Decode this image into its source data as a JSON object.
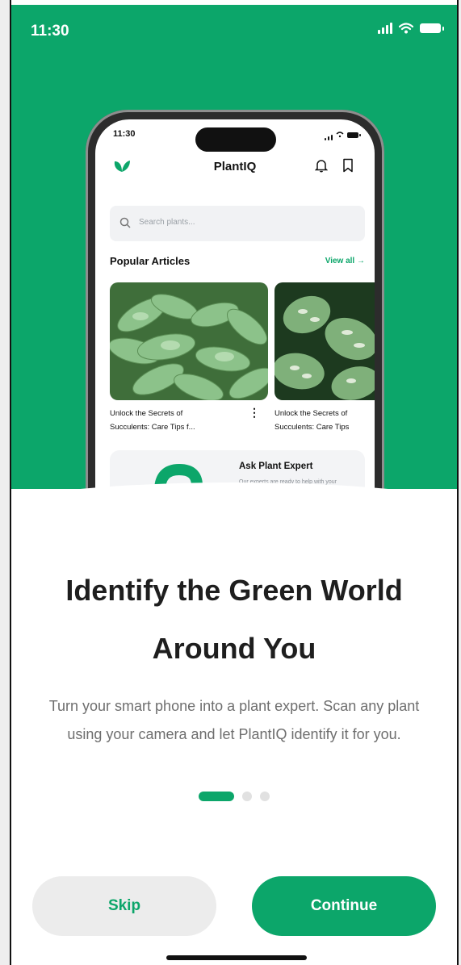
{
  "status_bar": {
    "time": "11:30"
  },
  "mockup": {
    "time": "11:30",
    "app_title": "PlantIQ",
    "search_placeholder": "Search plants...",
    "section_title": "Popular Articles",
    "view_all": "View all →",
    "articles": [
      {
        "caption": "Unlock the Secrets of\nSucculents: Care Tips f..."
      },
      {
        "caption": "Unlock the Secrets of\nSucculents: Care Tips"
      }
    ],
    "ask": {
      "title": "Ask Plant Expert",
      "description": "Our experts are ready to help with your problems."
    }
  },
  "onboarding": {
    "headline": "Identify the Green World Around You",
    "subtitle": "Turn your smart phone into a plant expert. Scan any plant using your camera and let PlantIQ identify it for you.",
    "page_count": 3,
    "active_page": 1
  },
  "buttons": {
    "skip": "Skip",
    "continue": "Continue"
  },
  "colors": {
    "brand_green": "#0ca66a",
    "skip_bg": "#ececec",
    "text_dark": "#1e1e1e",
    "text_muted": "#6e6e6e"
  }
}
